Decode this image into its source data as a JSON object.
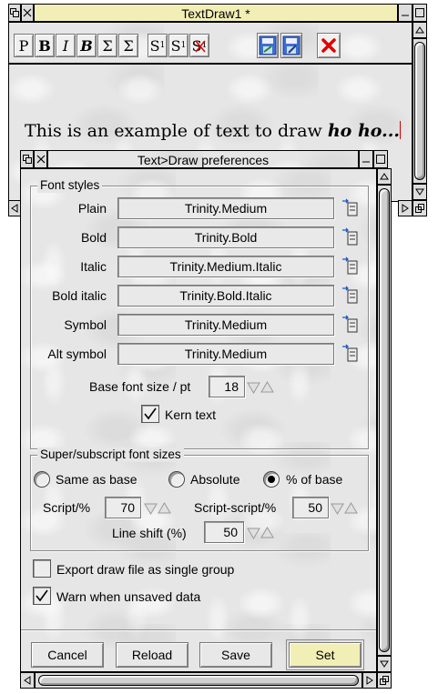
{
  "main_window": {
    "title": "TextDraw1 *",
    "toolbar": [
      {
        "name": "plain-button",
        "label": "P"
      },
      {
        "name": "bold-button",
        "label": "B"
      },
      {
        "name": "italic-button",
        "label": "I"
      },
      {
        "name": "bold-italic-button",
        "label": "B"
      },
      {
        "name": "symbol-button",
        "label": "Σ"
      },
      {
        "name": "alt-symbol-button",
        "label": "Σ"
      },
      {
        "name": "superscript-button",
        "label": "S",
        "sub": "1"
      },
      {
        "name": "subscript-button",
        "label": "S",
        "sub": "1"
      },
      {
        "name": "shift-button",
        "label": "S",
        "sub": "1"
      }
    ],
    "document_text": "This is an example of text to draw",
    "document_text_bold_italic": "ho ho..."
  },
  "dialog": {
    "title": "Text>Draw preferences",
    "font_styles": {
      "heading": "Font styles",
      "rows": [
        {
          "label": "Plain",
          "value": "Trinity.Medium"
        },
        {
          "label": "Bold",
          "value": "Trinity.Bold"
        },
        {
          "label": "Italic",
          "value": "Trinity.Medium.Italic"
        },
        {
          "label": "Bold italic",
          "value": "Trinity.Bold.Italic"
        },
        {
          "label": "Symbol",
          "value": "Trinity.Medium"
        },
        {
          "label": "Alt symbol",
          "value": "Trinity.Medium"
        }
      ],
      "base_size_label": "Base font size / pt",
      "base_size_value": "18",
      "kern_label": "Kern text",
      "kern_checked": true
    },
    "super_sub": {
      "heading": "Super/subscript font sizes",
      "options": [
        {
          "label": "Same as base",
          "selected": false
        },
        {
          "label": "Absolute",
          "selected": false
        },
        {
          "label": "% of base",
          "selected": true
        }
      ],
      "script_label": "Script/%",
      "script_value": "70",
      "scriptscript_label": "Script-script/%",
      "scriptscript_value": "50",
      "lineshift_label": "Line shift (%)",
      "lineshift_value": "50"
    },
    "export_label": "Export draw file as single group",
    "export_checked": false,
    "warn_label": "Warn when unsaved data",
    "warn_checked": true,
    "buttons": {
      "cancel": "Cancel",
      "reload": "Reload",
      "save": "Save",
      "set": "Set"
    }
  },
  "colors": {
    "title_active": "#f2efb6",
    "window_grey": "#dddddd",
    "cancel_red": "#e00000",
    "caret_red": "#d00000"
  }
}
